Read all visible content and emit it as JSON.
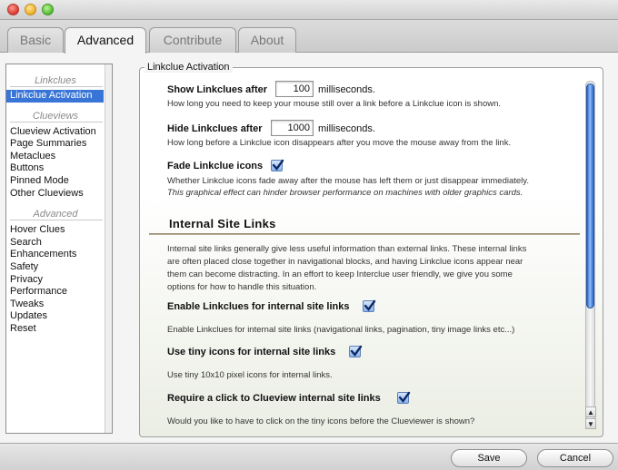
{
  "window": {
    "title": ""
  },
  "tabs": [
    {
      "label": "Basic"
    },
    {
      "label": "Advanced"
    },
    {
      "label": "Contribute"
    },
    {
      "label": "About"
    }
  ],
  "sidebar": {
    "sections": [
      {
        "heading": "Linkclues",
        "items": [
          "Linkclue Activation"
        ]
      },
      {
        "heading": "Clueviews",
        "items": [
          "Clueview Activation",
          "Page Summaries",
          "Metaclues",
          "Buttons",
          "Pinned Mode",
          "Other Clueviews"
        ]
      },
      {
        "heading": "Advanced",
        "items": [
          "Hover Clues",
          "Search Enhancements",
          "Safety",
          "Privacy",
          "Performance Tweaks",
          "Updates",
          "Reset"
        ]
      }
    ],
    "selected": "Linkclue Activation"
  },
  "group": {
    "legend": "Linkclue Activation",
    "show_after": {
      "label": "Show Linkclues after",
      "value": "100",
      "unit": "milliseconds.",
      "desc": "How long you need to keep your mouse still over a link before a Linkclue icon is shown."
    },
    "hide_after": {
      "label": "Hide Linkclues after",
      "value": "1000",
      "unit": "milliseconds.",
      "desc": "How long before a Linkclue icon disappears after you move the mouse away from the link."
    },
    "fade": {
      "label": "Fade Linkclue icons",
      "checked": true,
      "desc1": "Whether Linkclue icons fade away after the mouse has left them or just disappear immediately.",
      "desc2": "This graphical effect can hinder browser performance on machines with older graphics cards."
    },
    "internal": {
      "heading": "Internal Site Links",
      "intro": [
        "Internal site links generally give less useful information than external links. These internal links",
        "are often placed close together in navigational blocks, and having Linkclue icons appear near",
        "them can become distracting. In an effort to keep Interclue user friendly, we give you some",
        "options for how to handle this situation."
      ],
      "enable": {
        "label": "Enable Linkclues for internal site links",
        "checked": true,
        "desc": "Enable Linkclues for internal site links (navigational links, pagination, tiny image links etc...)"
      },
      "tiny": {
        "label": "Use tiny icons for internal site links",
        "checked": true,
        "desc": "Use tiny 10x10 pixel icons for internal links."
      },
      "click": {
        "label": "Require a click to Clueview internal site links",
        "checked": true,
        "desc": "Would you like to have to click on the tiny icons before the Clueviewer is shown?"
      }
    }
  },
  "buttons": {
    "save": "Save",
    "cancel": "Cancel"
  },
  "colors": {
    "selection": "#3875d7",
    "scroll_thumb": "#2a64cf"
  }
}
